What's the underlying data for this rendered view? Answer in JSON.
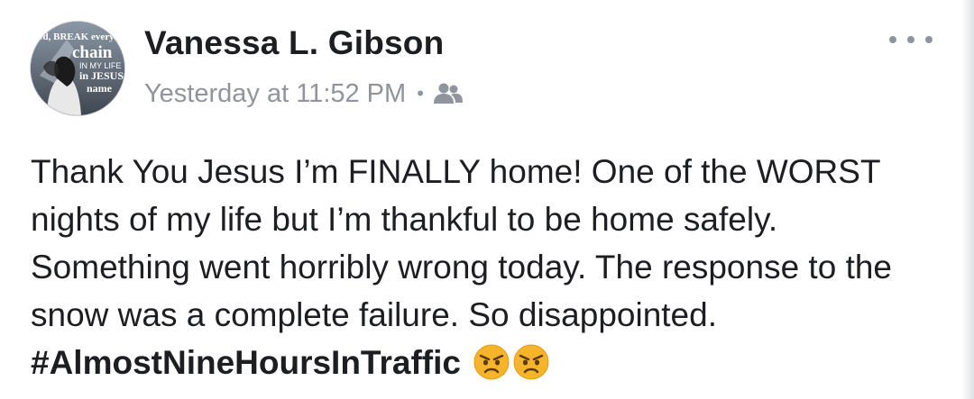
{
  "post": {
    "author": "Vanessa L. Gibson",
    "timestamp": "Yesterday at 11:52 PM",
    "separator": "•",
    "audience_icon": "friends-icon",
    "menu_icon": "more-horizontal-icon",
    "avatar": {
      "lines": [
        "od, BREAK every",
        "chain",
        "IN MY LIFE",
        "in JESUS",
        "name"
      ]
    },
    "body": {
      "text": "Thank You Jesus I’m FINALLY home! One of the WORST nights of my life but I’m thankful to be home safely.  Something went horribly wrong today. The response to the snow was a complete failure. So disappointed.",
      "hashtag": "#AlmostNineHoursInTraffic",
      "emojis": [
        "angry-face-emoji",
        "angry-face-emoji"
      ]
    }
  },
  "colors": {
    "author": "#1c1e21",
    "meta": "#90949c",
    "emoji_face": "#f5b42a"
  }
}
